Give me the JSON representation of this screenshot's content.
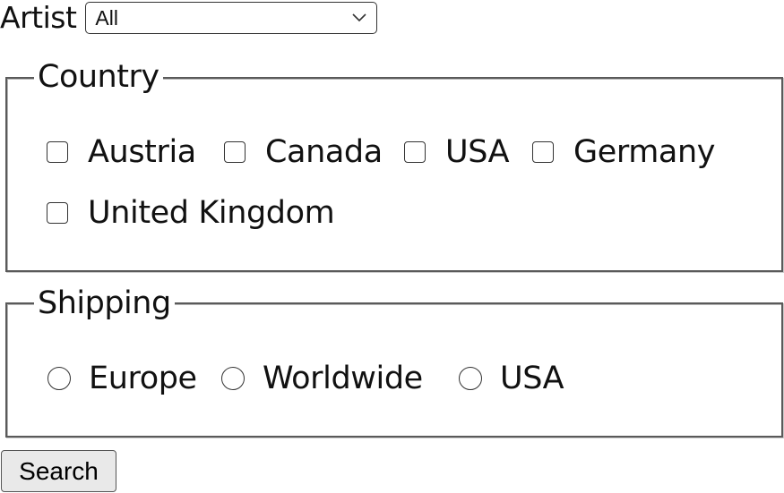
{
  "artist": {
    "label": "Artist",
    "selected": "All"
  },
  "country": {
    "legend": "Country",
    "options": [
      {
        "label": "Austria",
        "checked": false
      },
      {
        "label": "Canada",
        "checked": false
      },
      {
        "label": "USA",
        "checked": false
      },
      {
        "label": "Germany",
        "checked": false
      },
      {
        "label": "United Kingdom",
        "checked": false
      }
    ]
  },
  "shipping": {
    "legend": "Shipping",
    "options": [
      {
        "label": "Europe",
        "selected": false
      },
      {
        "label": "Worldwide",
        "selected": false
      },
      {
        "label": "USA",
        "selected": false
      }
    ]
  },
  "search_button": {
    "label": "Search"
  },
  "icons": {
    "select_arrow": "chevron-down-icon",
    "checkbox": "checkbox-unchecked-icon",
    "radio": "radio-unselected-icon"
  }
}
